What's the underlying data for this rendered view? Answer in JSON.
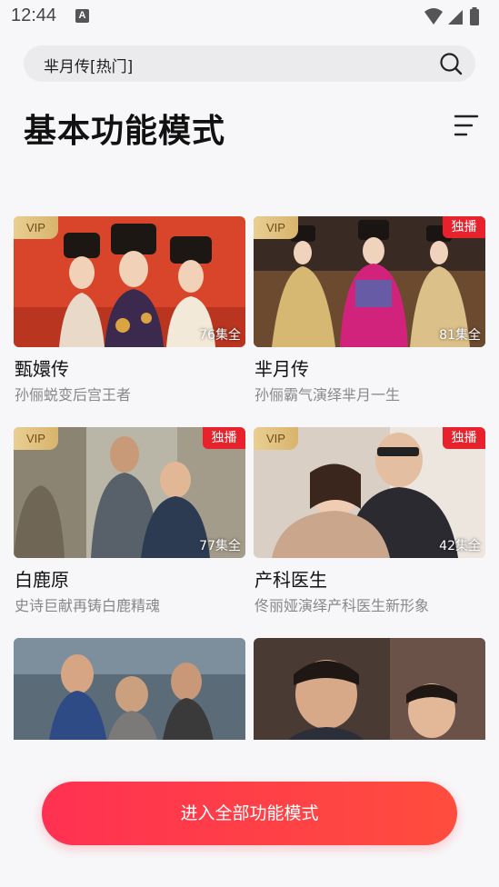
{
  "status_bar": {
    "time": "12:44",
    "notification_glyph": "A"
  },
  "search": {
    "query": "芈月传[热门]"
  },
  "header": {
    "title": "基本功能模式"
  },
  "items": [
    {
      "title": "甄嬛传",
      "subtitle": "孙俪蜕变后宫王者",
      "vip": "VIP",
      "badge": "",
      "episodes": "76集全"
    },
    {
      "title": "芈月传",
      "subtitle": "孙俪霸气演绎芈月一生",
      "vip": "VIP",
      "badge": "独播",
      "episodes": "81集全"
    },
    {
      "title": "白鹿原",
      "subtitle": "史诗巨献再铸白鹿精魂",
      "vip": "VIP",
      "badge": "独播",
      "episodes": "77集全"
    },
    {
      "title": "产科医生",
      "subtitle": "佟丽娅演绎产科医生新形象",
      "vip": "VIP",
      "badge": "独播",
      "episodes": "42集全"
    }
  ],
  "cta": {
    "label": "进入全部功能模式"
  },
  "colors": {
    "accent": "#ff3152",
    "badge_red": "#e8222c",
    "vip_gold": "#e0c27e"
  }
}
